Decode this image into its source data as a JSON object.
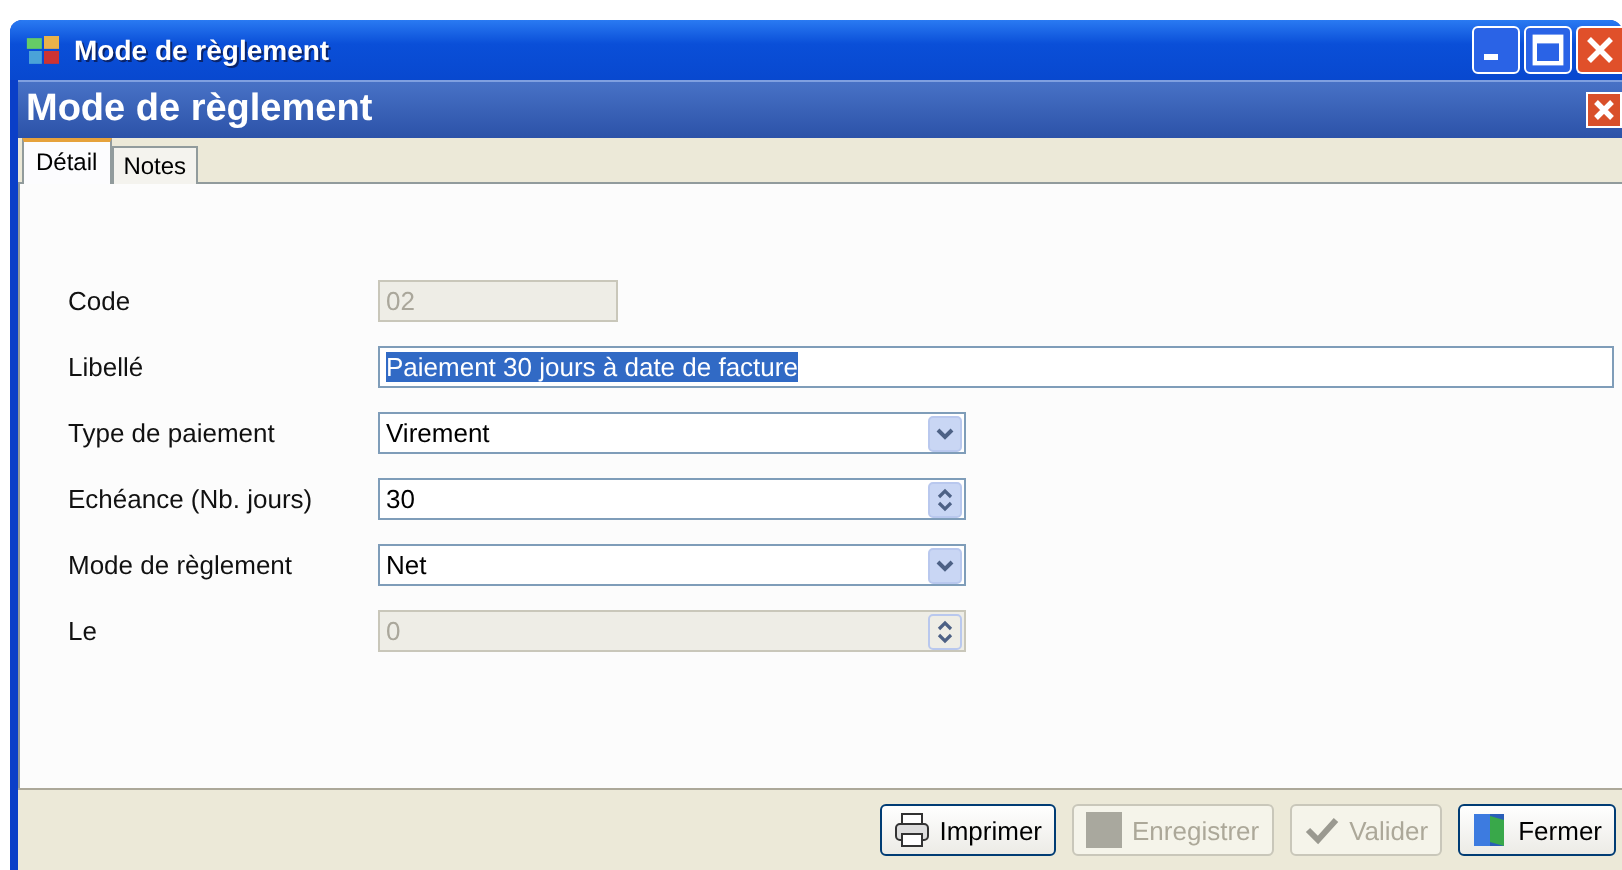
{
  "window": {
    "title": "Mode de règlement"
  },
  "header": {
    "title": "Mode de règlement"
  },
  "tabs": [
    {
      "label": "Détail",
      "selected": true
    },
    {
      "label": "Notes",
      "selected": false
    }
  ],
  "fields": [
    {
      "kind": "short",
      "label": "Code",
      "value": "02",
      "disabled": true
    },
    {
      "kind": "text",
      "label": "Libellé",
      "value": "Paiement 30 jours à date de facture",
      "disabled": false,
      "highlighted": true
    },
    {
      "kind": "combo",
      "label": "Type de paiement",
      "value": "Virement",
      "disabled": false
    },
    {
      "kind": "spin",
      "label": "Echéance (Nb. jours)",
      "value": "30",
      "disabled": false
    },
    {
      "kind": "combo",
      "label": "Mode de règlement",
      "value": "Net",
      "disabled": false
    },
    {
      "kind": "spin",
      "label": "Le",
      "value": "0",
      "disabled": true
    }
  ],
  "buttons": [
    {
      "kind": "print",
      "label": "Imprimer",
      "disabled": false
    },
    {
      "kind": "save",
      "label": "Enregistrer",
      "disabled": true
    },
    {
      "kind": "check",
      "label": "Valider",
      "disabled": true
    },
    {
      "kind": "door",
      "label": "Fermer",
      "disabled": false
    }
  ]
}
